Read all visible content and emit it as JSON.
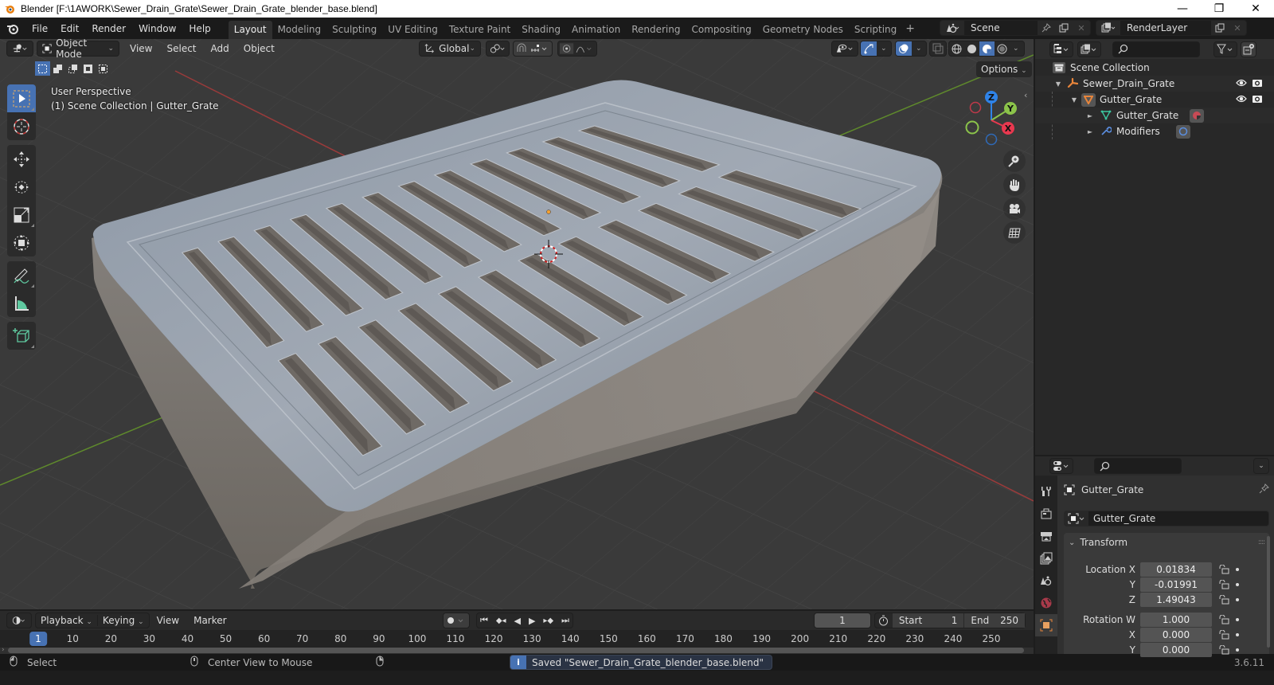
{
  "window": {
    "title": "Blender [F:\\1AWORK\\Sewer_Drain_Grate\\Sewer_Drain_Grate_blender_base.blend]",
    "controls": [
      "minimize-icon",
      "restore-icon",
      "close-icon"
    ]
  },
  "menubar": {
    "items": [
      "File",
      "Edit",
      "Render",
      "Window",
      "Help"
    ]
  },
  "workspaces": {
    "active": "Layout",
    "tabs": [
      "Layout",
      "Modeling",
      "Sculpting",
      "UV Editing",
      "Texture Paint",
      "Shading",
      "Animation",
      "Rendering",
      "Compositing",
      "Geometry Nodes",
      "Scripting"
    ],
    "add_label": "+"
  },
  "scene": {
    "name": "Scene",
    "view_layer": "RenderLayer"
  },
  "viewport": {
    "mode": "Object Mode",
    "menus": [
      "View",
      "Select",
      "Add",
      "Object"
    ],
    "transform_orientation": "Global",
    "options_label": "Options",
    "overlay_line1": "User Perspective",
    "overlay_line2": "(1) Scene Collection | Gutter_Grate",
    "gizmo_axes": [
      "Z",
      "Y",
      "X"
    ],
    "shading_active": "material-preview",
    "colors": {
      "x_axis": "#e8384f",
      "y_axis": "#8bc34a",
      "z_axis": "#2f83e8",
      "active": "#4772b3"
    }
  },
  "toolbar": {
    "tools": [
      "select-box",
      "cursor",
      "move",
      "rotate",
      "scale",
      "transform",
      "annotate",
      "measure",
      "add-cube"
    ],
    "active": "select-box"
  },
  "outliner": {
    "root": "Scene Collection",
    "items": [
      {
        "label": "Sewer_Drain_Grate",
        "type": "empty",
        "depth": 1,
        "expanded": true
      },
      {
        "label": "Gutter_Grate",
        "type": "mesh-object",
        "depth": 2,
        "expanded": true
      },
      {
        "label": "Gutter_Grate",
        "type": "mesh-data",
        "depth": 3,
        "expanded": false
      },
      {
        "label": "Modifiers",
        "type": "modifiers",
        "depth": 3,
        "expanded": false
      }
    ]
  },
  "properties": {
    "object_name": "Gutter_Grate",
    "datablock_name": "Gutter_Grate",
    "panel": "Transform",
    "fields": [
      {
        "label": "Location X",
        "value": "0.01834"
      },
      {
        "label": "Y",
        "value": "-0.01991"
      },
      {
        "label": "Z",
        "value": "1.49043"
      },
      {
        "label": "Rotation W",
        "value": "1.000"
      },
      {
        "label": "X",
        "value": "0.000"
      },
      {
        "label": "Y",
        "value": "0.000"
      }
    ]
  },
  "timeline": {
    "menus": [
      "Playback",
      "Keying",
      "View",
      "Marker"
    ],
    "current_frame": "1",
    "start_label": "Start",
    "start": "1",
    "end_label": "End",
    "end": "250",
    "ruler": [
      "10",
      "20",
      "30",
      "40",
      "50",
      "60",
      "70",
      "80",
      "90",
      "100",
      "110",
      "120",
      "130",
      "140",
      "150",
      "160",
      "170",
      "180",
      "190",
      "200",
      "210",
      "220",
      "230",
      "240",
      "250"
    ]
  },
  "statusbar": {
    "left_action": "Select",
    "middle_action": "Center View to Mouse",
    "message": "Saved \"Sewer_Drain_Grate_blender_base.blend\"",
    "version": "3.6.11"
  }
}
